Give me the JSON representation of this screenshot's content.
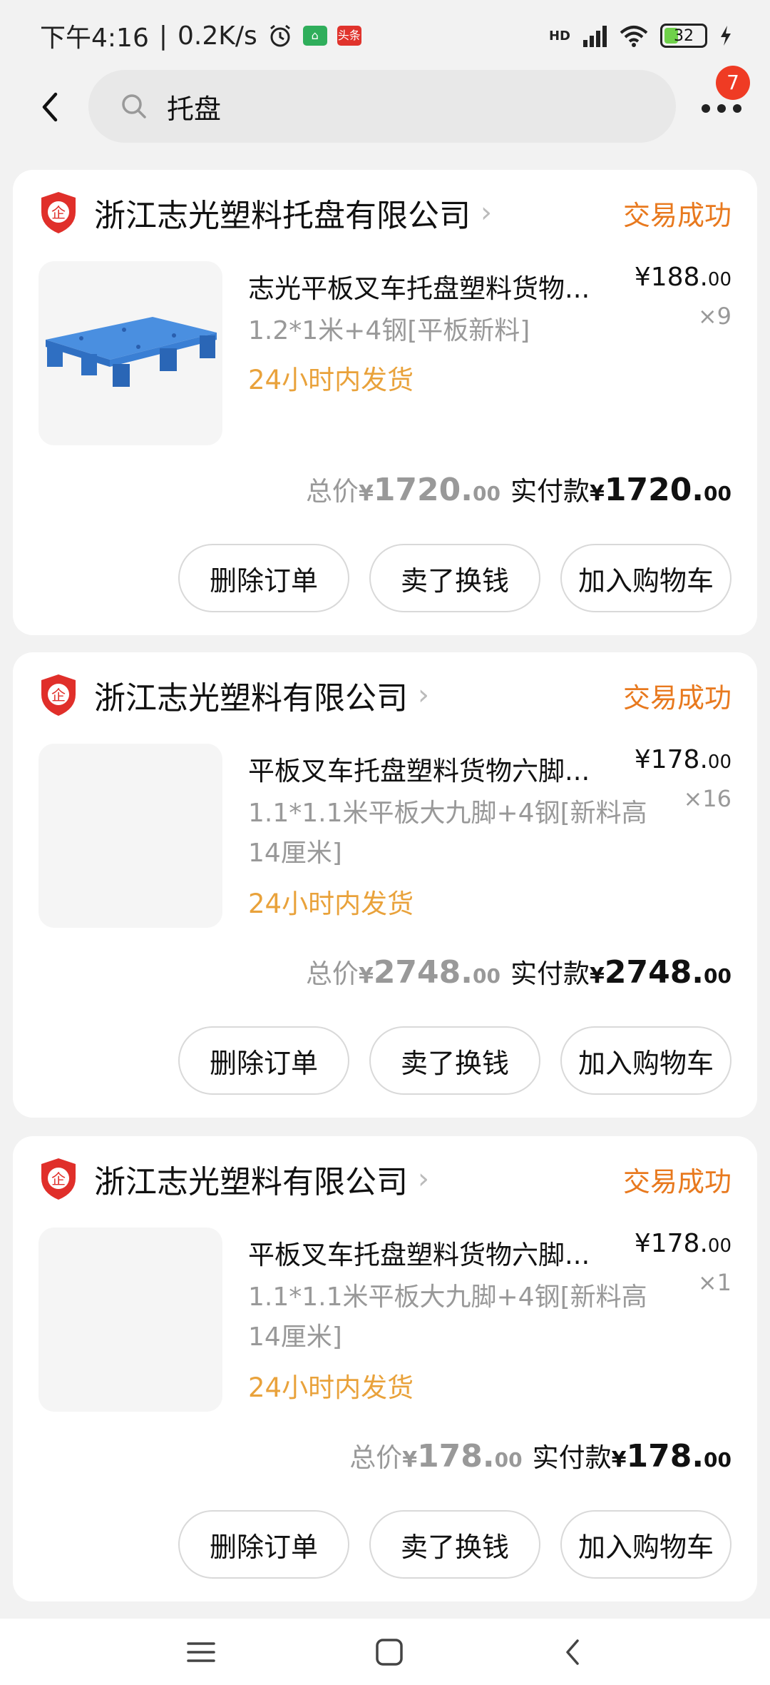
{
  "status_bar": {
    "time": "下午4:16",
    "speed": "0.2K/s",
    "news_label": "头条",
    "network": "HD",
    "battery": "32"
  },
  "search": {
    "query": "托盘",
    "notification_count": "7"
  },
  "orders": [
    {
      "store": "浙江志光塑料托盘有限公司",
      "status": "交易成功",
      "title": "志光平板叉车托盘塑料货物...",
      "spec": "1.2*1米+4钢[平板新料]",
      "ship": "24小时内发货",
      "unit_price_int": "¥188.",
      "unit_price_dec": "00",
      "qty": "×9",
      "total_label": "总价",
      "total_cur": "¥",
      "total_int": "1720.",
      "total_dec": "00",
      "paid_label": "实付款",
      "paid_cur": "¥",
      "paid_int": "1720.",
      "paid_dec": "00",
      "buttons": [
        "删除订单",
        "卖了换钱",
        "加入购物车"
      ]
    },
    {
      "store": "浙江志光塑料有限公司",
      "status": "交易成功",
      "title": "平板叉车托盘塑料货物六脚...",
      "spec": "1.1*1.1米平板大九脚+4钢[新料高14厘米]",
      "ship": "24小时内发货",
      "unit_price_int": "¥178.",
      "unit_price_dec": "00",
      "qty": "×16",
      "total_label": "总价",
      "total_cur": "¥",
      "total_int": "2748.",
      "total_dec": "00",
      "paid_label": "实付款",
      "paid_cur": "¥",
      "paid_int": "2748.",
      "paid_dec": "00",
      "buttons": [
        "删除订单",
        "卖了换钱",
        "加入购物车"
      ]
    },
    {
      "store": "浙江志光塑料有限公司",
      "status": "交易成功",
      "title": "平板叉车托盘塑料货物六脚...",
      "spec": "1.1*1.1米平板大九脚+4钢[新料高14厘米]",
      "ship": "24小时内发货",
      "unit_price_int": "¥178.",
      "unit_price_dec": "00",
      "qty": "×1",
      "total_label": "总价",
      "total_cur": "¥",
      "total_int": "178.",
      "total_dec": "00",
      "paid_label": "实付款",
      "paid_cur": "¥",
      "paid_int": "178.",
      "paid_dec": "00",
      "buttons": [
        "删除订单",
        "卖了换钱",
        "加入购物车"
      ]
    }
  ],
  "colors": {
    "accent_orange": "#e8791e",
    "ship_orange": "#e9a23b",
    "store_red": "#e02f2a",
    "badge_red": "#ef3b24"
  },
  "icons": {
    "back": "back-arrow-icon",
    "search": "search-icon",
    "more": "more-dots-icon",
    "store": "enterprise-shield-icon",
    "menu": "menu-icon",
    "home": "home-square-icon",
    "nav_back": "nav-back-icon"
  }
}
